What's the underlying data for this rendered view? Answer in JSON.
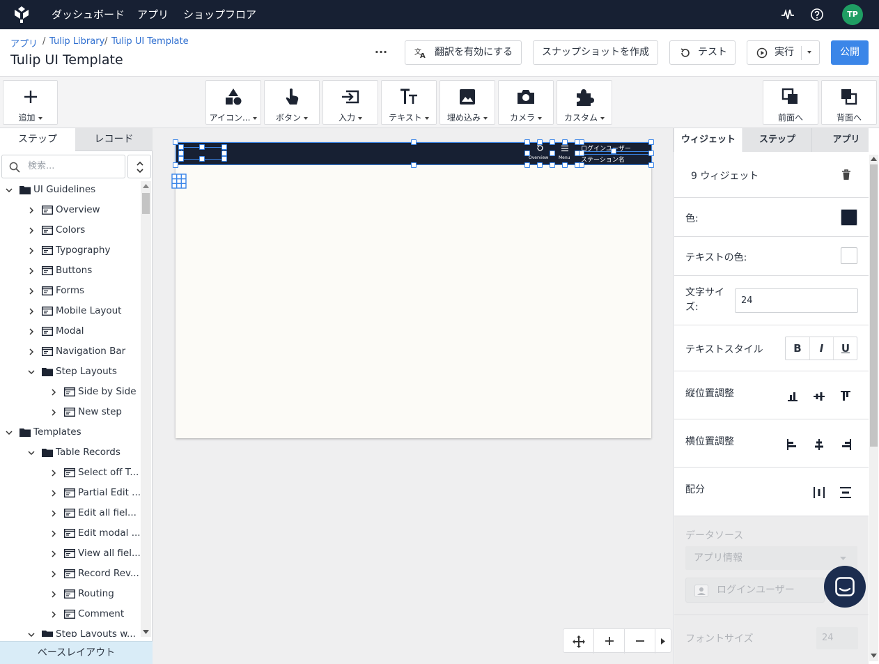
{
  "topnav": {
    "items": [
      "ダッシュボード",
      "アプリ",
      "ショップフロア"
    ],
    "avatar": "TP",
    "icons": [
      "pulse-icon",
      "help-icon"
    ]
  },
  "header": {
    "breadcrumb": [
      "アプリ",
      "Tulip Library",
      "Tulip UI Template"
    ],
    "title": "Tulip UI Template",
    "more": "···",
    "buttons": {
      "translate": "翻訳を有効にする",
      "snapshot": "スナップショットを作成",
      "test": "テスト",
      "run": "実行",
      "publish": "公開"
    }
  },
  "toolbar": {
    "add": "追加",
    "tools": [
      "アイコン...",
      "ボタン",
      "入力",
      "テキスト",
      "埋め込み",
      "カメラ",
      "カスタム"
    ],
    "front": "前面へ",
    "back": "背面へ"
  },
  "left": {
    "tabs": [
      "ステップ",
      "レコード"
    ],
    "search_placeholder": "検索...",
    "tree": [
      {
        "label": "UI Guidelines",
        "type": "folder",
        "level": 0,
        "open": true
      },
      {
        "label": "Overview",
        "type": "step",
        "level": 1
      },
      {
        "label": "Colors",
        "type": "step",
        "level": 1
      },
      {
        "label": "Typography",
        "type": "step",
        "level": 1
      },
      {
        "label": "Buttons",
        "type": "step",
        "level": 1
      },
      {
        "label": "Forms",
        "type": "step",
        "level": 1
      },
      {
        "label": "Mobile Layout",
        "type": "step",
        "level": 1
      },
      {
        "label": "Modal",
        "type": "step",
        "level": 1
      },
      {
        "label": "Navigation Bar",
        "type": "step",
        "level": 1
      },
      {
        "label": "Step Layouts",
        "type": "folder",
        "level": 1,
        "open": true
      },
      {
        "label": "Side by Side",
        "type": "step",
        "level": 2
      },
      {
        "label": "New step",
        "type": "step",
        "level": 2
      },
      {
        "label": "Templates",
        "type": "folder",
        "level": 0,
        "open": true
      },
      {
        "label": "Table Records",
        "type": "folder",
        "level": 1,
        "open": true
      },
      {
        "label": "Select off T...",
        "type": "step",
        "level": 2
      },
      {
        "label": "Partial Edit ...",
        "type": "step",
        "level": 2
      },
      {
        "label": "Edit all fiel...",
        "type": "step",
        "level": 2
      },
      {
        "label": "Edit modal ...",
        "type": "step",
        "level": 2
      },
      {
        "label": "View all fiel...",
        "type": "step",
        "level": 2
      },
      {
        "label": "Record Rev...",
        "type": "step",
        "level": 2
      },
      {
        "label": "Routing",
        "type": "step",
        "level": 2
      },
      {
        "label": "Comment",
        "type": "step",
        "level": 2
      },
      {
        "label": "Step Layouts w...",
        "type": "folder",
        "level": 1,
        "open": true
      }
    ],
    "base_layout": "ベースレイアウト"
  },
  "canvas": {
    "overview_label": "Overview",
    "menu_label": "Menu",
    "user_label": "ログインユーザー",
    "station_label": "ステーション名"
  },
  "right": {
    "tabs": [
      "ウィジェット",
      "ステップ",
      "アプリ"
    ],
    "widget_count": "9 ウィジェット",
    "color_label": "色:",
    "color_value": "#172033",
    "text_color_label": "テキストの色:",
    "text_color_value": "#ffffff",
    "font_size_label": "文字サイズ:",
    "font_size_value": "24",
    "text_style_label": "テキストスタイル",
    "text_style_buttons": [
      "B",
      "I",
      "U"
    ],
    "valign_label": "縦位置調整",
    "halign_label": "横位置調整",
    "distribute_label": "配分",
    "datasource_label": "データソース",
    "datasource_value": "アプリ情報",
    "user_value": "ログインユーザー",
    "font_size2_label": "フォントサイズ",
    "font_size2_value": "24"
  },
  "colors": {
    "nav": "#172033",
    "accent": "#3b86e8",
    "avatar": "#1f9e63"
  }
}
